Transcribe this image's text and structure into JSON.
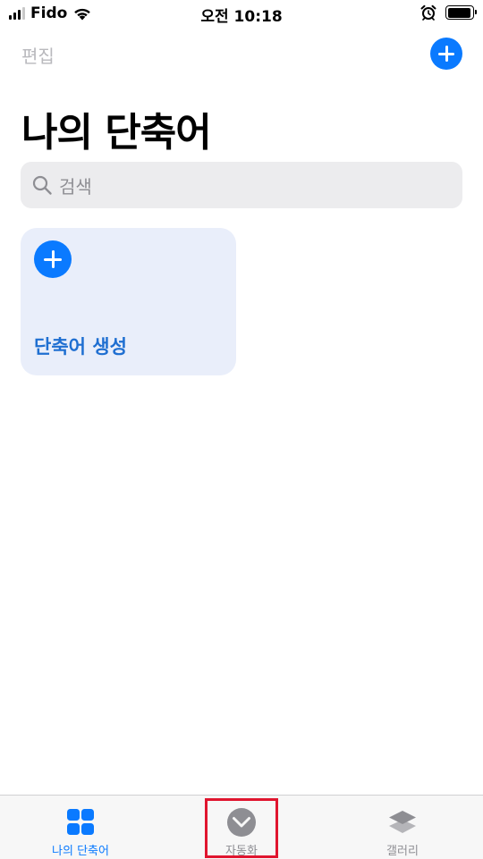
{
  "status_bar": {
    "carrier": "Fido",
    "time": "오전 10:18",
    "signal_bars": 3,
    "battery_level": 0.95
  },
  "nav": {
    "edit_label": "편집",
    "add_icon": "plus-circle-icon"
  },
  "page": {
    "title": "나의 단축어"
  },
  "search": {
    "placeholder": "검색",
    "icon": "search-icon"
  },
  "shortcuts": {
    "create_card": {
      "label": "단축어 생성",
      "icon": "plus-circle-icon"
    }
  },
  "tab_bar": {
    "tabs": [
      {
        "label": "나의 단축어",
        "icon": "grid-icon",
        "active": true
      },
      {
        "label": "자동화",
        "icon": "checkmark-clock-icon",
        "active": false
      },
      {
        "label": "갤러리",
        "icon": "layers-icon",
        "active": false
      }
    ]
  },
  "colors": {
    "accent": "#0a7aff",
    "card_background": "#e9eefa",
    "card_label": "#1f6fd1",
    "highlight": "#e0152f"
  }
}
